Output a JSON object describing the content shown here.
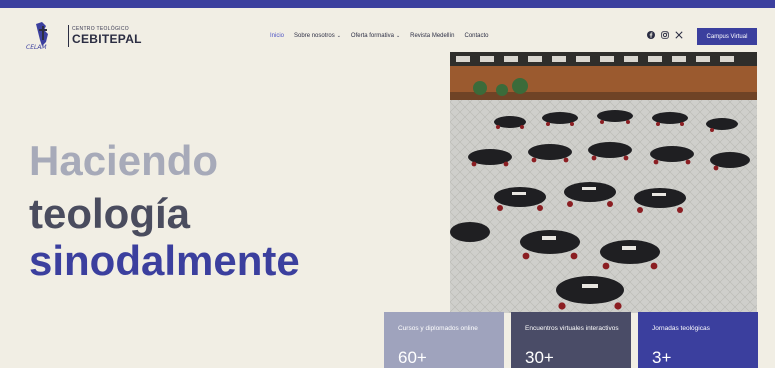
{
  "brand": {
    "logo_mark": "CELAM",
    "subtitle": "CENTRO TEOLÓGICO",
    "name": "CEBITEPAL"
  },
  "nav": [
    {
      "label": "Inicio",
      "active": true
    },
    {
      "label": "Sobre nosotros",
      "dropdown": true
    },
    {
      "label": "Oferta formativa",
      "dropdown": true
    },
    {
      "label": "Revista Medellín"
    },
    {
      "label": "Contacto"
    }
  ],
  "social_icons": [
    "facebook-icon",
    "instagram-icon",
    "x-icon"
  ],
  "cta_label": "Campus Virtual",
  "hero": {
    "line1": "Haciendo",
    "line2": "teología",
    "line3": "sinodalmente"
  },
  "stats": [
    {
      "label": "Cursos y diplomados online",
      "value": "60+"
    },
    {
      "label": "Encuentros virtuales interactivos",
      "value": "30+"
    },
    {
      "label": "Jornadas teológicas",
      "value": "3+"
    }
  ],
  "colors": {
    "accent": "#3b3f9e",
    "background": "#f1eee4",
    "hero_muted": "#a7aab9",
    "hero_dark": "#4a4c5e"
  }
}
